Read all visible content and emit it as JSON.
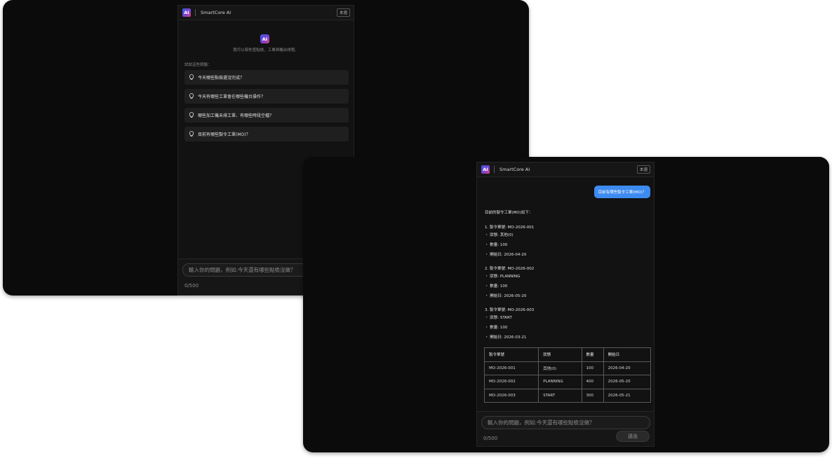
{
  "app": {
    "title": "SmartCore AI",
    "logo_text": "AI",
    "tag": "本週"
  },
  "welcome": {
    "description": "我可以幫你查點檢、工單與機台排程。",
    "suggest_label": "試試這些問題："
  },
  "suggestions": [
    "今天哪些點檢還沒完成？",
    "今天有哪些工單會在哪些機台操作？",
    "哪些加工機未排工單、有哪些時段空檔？",
    "目前有哪些製令工單(MO)？"
  ],
  "input": {
    "placeholder": "輸入你的問題，例如:今天還有哪些點檢沒做？",
    "counter": "0/500",
    "send_label": "送出"
  },
  "chat": {
    "user_message": "目前有哪些製令工單(MO)？",
    "reply_intro": "目前的製令工單(MO)如下：",
    "orders": [
      {
        "heading": "1. 製令單號: MO-2026-001",
        "status": "・ 狀態: 其他(0)",
        "qty": "・ 數量: 100",
        "start": "・ 開始日: 2026-04-20"
      },
      {
        "heading": "2. 製令單號: MO-2026-002",
        "status": "・ 狀態: PLANNING",
        "qty": "・ 數量: 100",
        "start": "・ 開始日: 2026-05-20"
      },
      {
        "heading": "3. 製令單號: MO-2026-003",
        "status": "・ 狀態: START",
        "qty": "・ 數量: 100",
        "start": "・ 開始日: 2026-03-21"
      }
    ],
    "table": {
      "headers": [
        "製令單號",
        "狀態",
        "數量",
        "開始日"
      ],
      "rows": [
        [
          "MO-2026-001",
          "其他(0)",
          "100",
          "2026-04-20"
        ],
        [
          "MO-2026-002",
          "PLANNING",
          "400",
          "2026-05-20"
        ],
        [
          "MO-2026-003",
          "START",
          "300",
          "2026-05-21"
        ]
      ]
    }
  },
  "colors": {
    "accent": "#3d8bf0",
    "background": "#0b0b0b",
    "panel": "#121212"
  }
}
